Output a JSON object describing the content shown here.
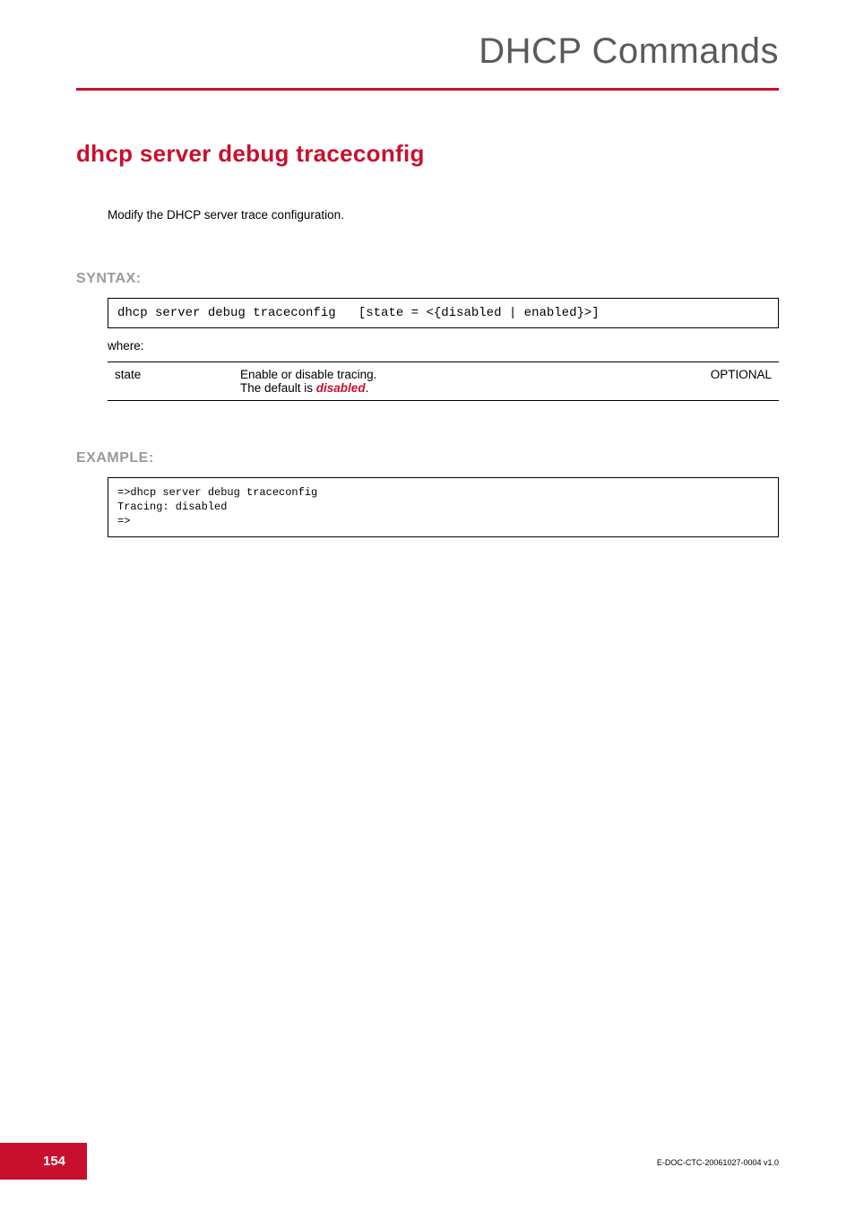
{
  "header": {
    "title": "DHCP Commands"
  },
  "section": {
    "title": "dhcp server debug traceconfig",
    "desc": "Modify the DHCP server trace configuration."
  },
  "syntax": {
    "label": "SYNTAX:",
    "code": "dhcp server debug traceconfig   [state = <{disabled | enabled}>]",
    "where": "where:",
    "params": [
      {
        "name": "state",
        "desc_prefix": "Enable or disable tracing.\nThe default is ",
        "desc_emph": "disabled",
        "desc_suffix": ".",
        "req": "OPTIONAL"
      }
    ]
  },
  "example": {
    "label": "EXAMPLE:",
    "code": "=>dhcp server debug traceconfig\nTracing: disabled\n=>"
  },
  "footer": {
    "page": "154",
    "docid": "E-DOC-CTC-20061027-0004 v1.0"
  }
}
